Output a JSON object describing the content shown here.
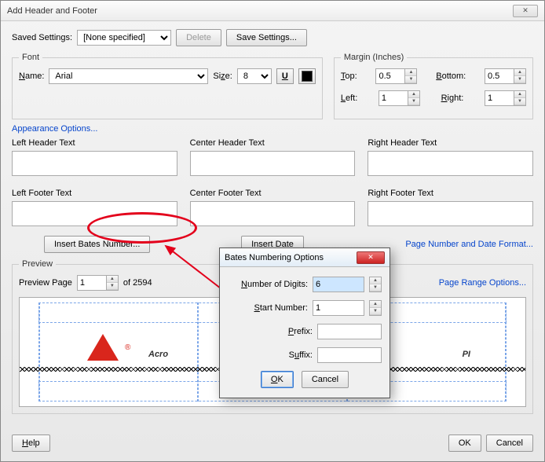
{
  "window": {
    "title": "Add Header and Footer"
  },
  "saved": {
    "label": "Saved Settings:",
    "value": "[None specified]",
    "delete": "Delete",
    "save": "Save Settings..."
  },
  "font": {
    "legend": "Font",
    "nameLabel": "Name:",
    "nameValue": "Arial",
    "sizeLabel": "Size:",
    "sizeValue": "8",
    "underline": "U"
  },
  "appearance": "Appearance Options...",
  "margin": {
    "legend": "Margin (Inches)",
    "topLabel": "Top:",
    "topValue": "0.5",
    "bottomLabel": "Bottom:",
    "bottomValue": "0.5",
    "leftLabel": "Left:",
    "leftValue": "1",
    "rightLabel": "Right:",
    "rightValue": "1"
  },
  "hf": {
    "lh": "Left Header Text",
    "ch": "Center Header Text",
    "rh": "Right Header Text",
    "lf": "Left Footer Text",
    "cf": "Center Footer Text",
    "rf": "Right Footer Text"
  },
  "btns": {
    "bates": "Insert Bates Number...",
    "date": "Insert Date",
    "pnf": "Page Number and Date Format..."
  },
  "preview": {
    "legend": "Preview",
    "pp": "Preview Page",
    "ppv": "1",
    "of": "of 2594",
    "pro": "Page Range Options...",
    "logotext": "Acro",
    "logotext2": "PI"
  },
  "footer": {
    "help": "Help",
    "ok": "OK",
    "cancel": "Cancel"
  },
  "sub": {
    "title": "Bates Numbering Options",
    "nd": "Number of Digits:",
    "ndv": "6",
    "sn": "Start Number:",
    "snv": "1",
    "pf": "Prefix:",
    "sf": "Suffix:",
    "ok": "OK",
    "cancel": "Cancel"
  }
}
